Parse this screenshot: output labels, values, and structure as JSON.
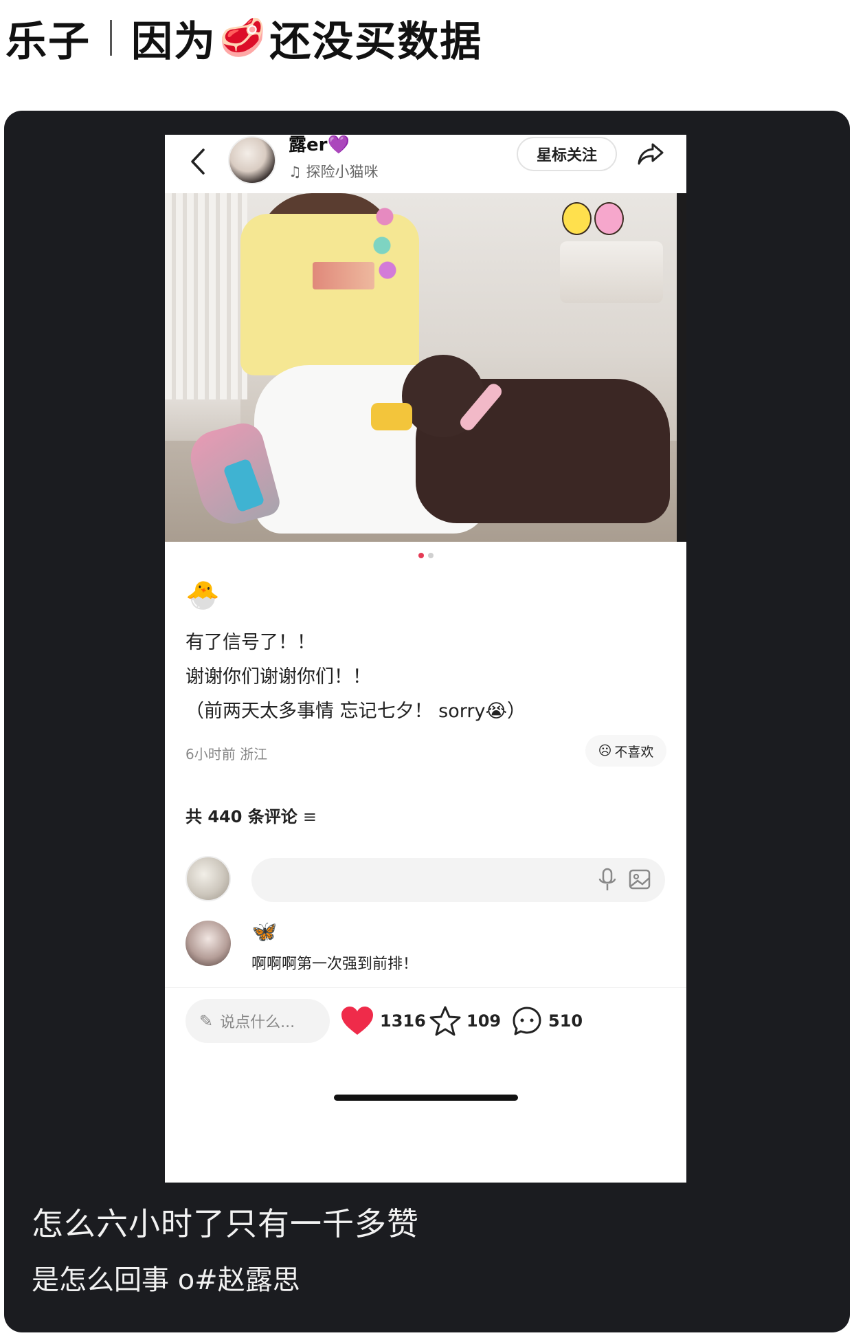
{
  "header": {
    "left": "乐子",
    "right_before_icon": "因为",
    "icon": "meat-emoji",
    "icon_glyph": "🥩",
    "right_after_icon": "还没买数据"
  },
  "post": {
    "user_name": "露er",
    "name_badge": "💜",
    "music": "♫ 探险小猫咪",
    "follow_label": "星标关注",
    "emoji": "🐣",
    "lines": [
      "有了信号了！！",
      "谢谢你们谢谢你们！！",
      "（前两天太多事情 忘记七夕！ sorry😭）"
    ],
    "meta": "6小时前 浙江",
    "dislike_label": "不喜欢",
    "comment_count_label": "共 440 条评论",
    "comment": {
      "badge": "🦋",
      "text": "啊啊啊第一次强到前排！"
    },
    "say_placeholder": "说点什么...",
    "likes": "1316",
    "stars": "109",
    "comments": "510",
    "image_pages": 2,
    "active_page": 1
  },
  "caption": {
    "line1": "怎么六小时了只有一千多赞",
    "line2": "是怎么回事 o#赵露思"
  },
  "colors": {
    "card_bg": "#1b1c20",
    "like_red": "#ef2b4a",
    "page_dot_active": "#e53b55"
  }
}
